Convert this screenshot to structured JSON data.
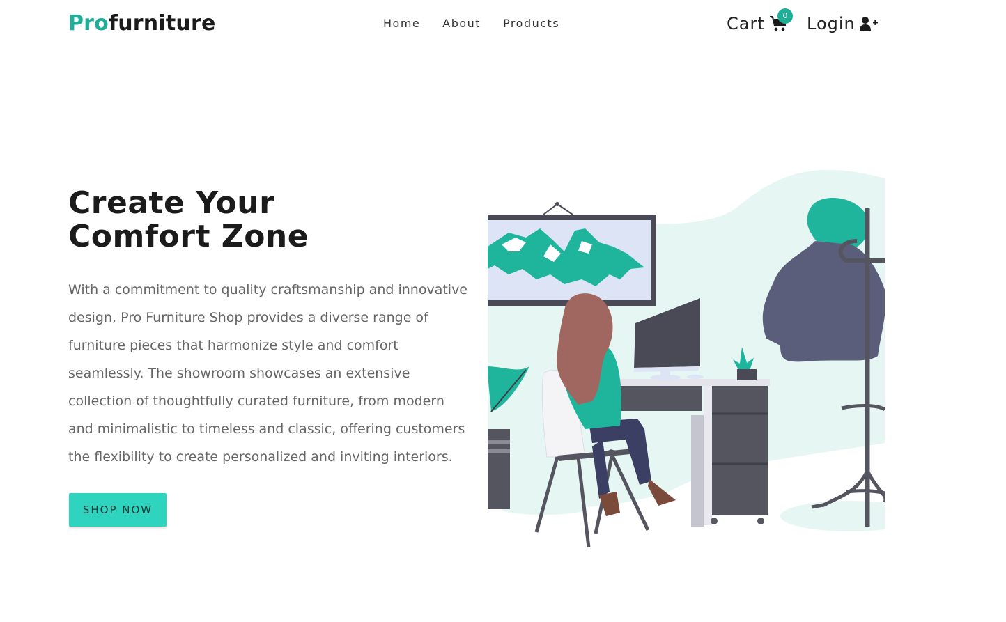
{
  "brand": {
    "pro": "Pro",
    "rest": "furniture"
  },
  "nav": {
    "links": [
      {
        "label": "Home"
      },
      {
        "label": "About"
      },
      {
        "label": "Products"
      }
    ],
    "cart_label": "Cart",
    "cart_count": "0",
    "login_label": "Login"
  },
  "hero": {
    "title_line1": "Create Your",
    "title_line2": "Comfort Zone",
    "description": "With a commitment to quality craftsmanship and innovative design, Pro Furniture Shop provides a diverse range of furniture pieces that harmonize style and comfort seamlessly. The showroom showcases an extensive collection of thoughtfully curated furniture, from modern and minimalistic to timeless and classic, offering customers the flexibility to create personalized and inviting interiors.",
    "button_label": "SHOP NOW"
  },
  "colors": {
    "accent": "#1fae97",
    "button": "#2fd4bf",
    "text_muted": "#666666",
    "illustration_bg": "#e6f6f3"
  },
  "icons": {
    "cart": "shopping-cart-icon",
    "login": "user-plus-icon"
  }
}
